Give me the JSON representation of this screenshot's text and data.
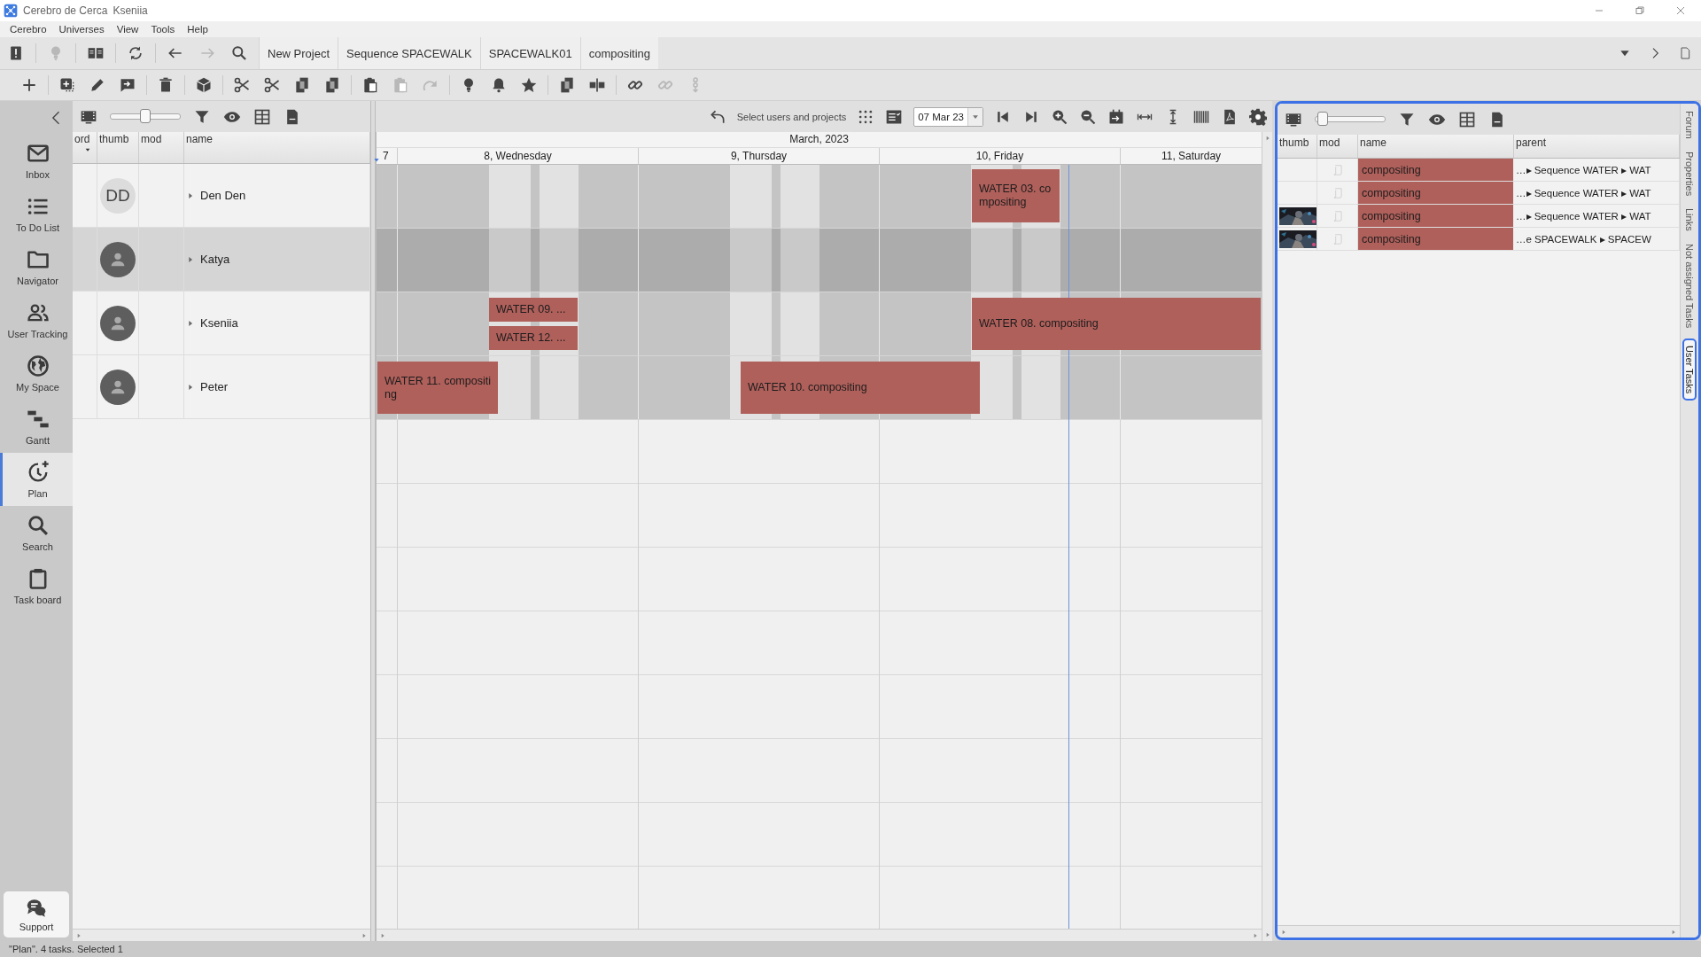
{
  "window": {
    "title": "Cerebro de Cerca",
    "user": "Kseniia"
  },
  "menu": [
    "Cerebro",
    "Universes",
    "View",
    "Tools",
    "Help"
  ],
  "toolbar_top": [
    {
      "disabled": false
    },
    {
      "disabled": true
    },
    {
      "disabled": false
    },
    {
      "disabled": false
    },
    {
      "disabled": false
    },
    {
      "disabled": true
    },
    {
      "disabled": false
    }
  ],
  "breadcrumbs": [
    "New Project",
    "Sequence SPACEWALK",
    "SPACEWALK01",
    "compositing"
  ],
  "toolbar_actions": [
    {
      "disabled": false
    },
    {
      "disabled": false
    },
    {
      "disabled": false
    },
    {
      "disabled": false
    },
    {
      "disabled": false
    },
    {
      "disabled": false
    },
    {
      "disabled": false
    },
    {
      "disabled": false
    },
    {
      "disabled": false
    },
    {
      "disabled": false
    },
    {
      "disabled": false
    },
    {
      "disabled": true
    },
    {
      "disabled": true
    },
    {
      "disabled": false
    },
    {
      "disabled": false
    },
    {
      "disabled": false
    },
    {
      "disabled": false
    },
    {
      "disabled": false
    },
    {
      "disabled": false
    },
    {
      "disabled": true
    },
    {
      "disabled": true
    }
  ],
  "sidebar": {
    "items": [
      {
        "label": "Inbox",
        "selected": false
      },
      {
        "label": "To Do List",
        "selected": false
      },
      {
        "label": "Navigator",
        "selected": false
      },
      {
        "label": "User Tracking",
        "selected": false
      },
      {
        "label": "My Space",
        "selected": false
      },
      {
        "label": "Gantt",
        "selected": false
      },
      {
        "label": "Plan",
        "selected": true
      },
      {
        "label": "Search",
        "selected": false
      },
      {
        "label": "Task board",
        "selected": false
      }
    ],
    "support": "Support"
  },
  "users_panel": {
    "zoom": {
      "level": 0.5
    },
    "columns": [
      "ord",
      "thumb",
      "mod",
      "name"
    ],
    "rows": [
      {
        "name": "Den Den",
        "initials": "DD",
        "expanded": false,
        "selected": false
      },
      {
        "name": "Katya",
        "expanded": false,
        "selected": true
      },
      {
        "name": "Kseniia",
        "expanded": false,
        "selected": false
      },
      {
        "name": "Peter",
        "expanded": false,
        "selected": false
      }
    ]
  },
  "planner": {
    "filter_label": "Select users and projects",
    "date": "07 Mar 23",
    "month": "March, 2023",
    "days": [
      {
        "label": "7"
      },
      {
        "label": "8, Wednesday",
        "day_off": false
      },
      {
        "label": "9, Thursday",
        "day_off": false
      },
      {
        "label": "10, Friday",
        "day_off": false
      },
      {
        "label": "11, Saturday",
        "day_off": true
      }
    ],
    "rows": [
      {
        "tasks": [
          {
            "label": "WATER 03. compositing"
          }
        ]
      },
      {
        "tasks": []
      },
      {
        "tasks": [
          {
            "label": "WATER 09. ..."
          },
          {
            "label": "WATER 12. ..."
          },
          {
            "label": "WATER 08. compositing"
          }
        ]
      },
      {
        "tasks": [
          {
            "label": "WATER 11. compositing"
          },
          {
            "label": "WATER 10. compositing"
          }
        ]
      }
    ]
  },
  "tasks_panel": {
    "zoom": {
      "level": 0.1
    },
    "columns": [
      "thumb",
      "mod",
      "name",
      "parent"
    ],
    "rows": [
      {
        "name": "compositing",
        "parent": "…▸ Sequence WATER ▸ WAT"
      },
      {
        "name": "compositing",
        "parent": "…▸ Sequence WATER ▸ WAT"
      },
      {
        "name": "compositing",
        "parent": "…▸ Sequence WATER ▸ WAT"
      },
      {
        "name": "compositing",
        "parent": "…e SPACEWALK ▸ SPACEW"
      }
    ]
  },
  "side_tabs": [
    {
      "label": "Forum",
      "selected": false
    },
    {
      "label": "Properties",
      "selected": false
    },
    {
      "label": "Links",
      "selected": false
    },
    {
      "label": "Not assigned Tasks",
      "selected": false
    },
    {
      "label": "User Tasks",
      "selected": true
    }
  ],
  "status_bar": "\"Plan\". 4 tasks. Selected 1"
}
